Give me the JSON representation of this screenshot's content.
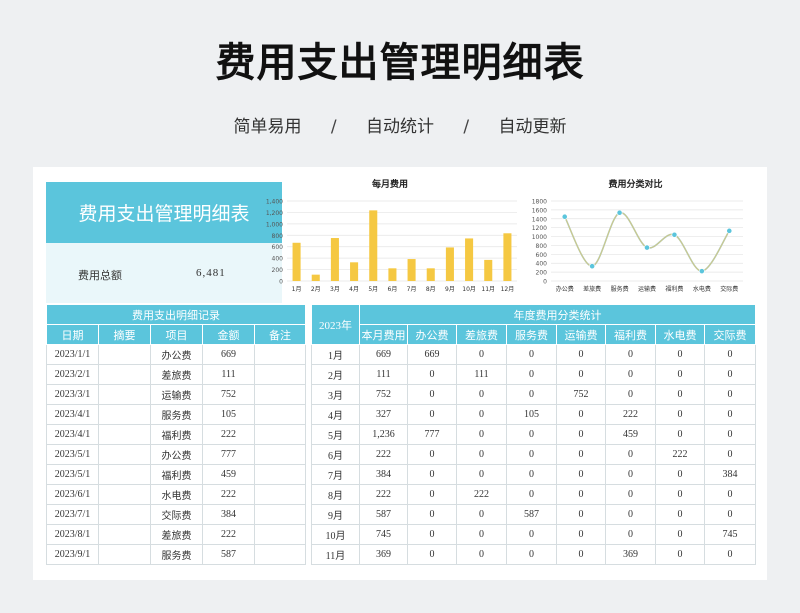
{
  "header": {
    "title": "费用支出管理明细表",
    "tagline": [
      "简单易用",
      "自动统计",
      "自动更新"
    ],
    "separator": "/"
  },
  "summary": {
    "banner_title": "费用支出管理明细表",
    "total_label": "费用总额",
    "total_value": "6,481"
  },
  "colors": {
    "accent": "#5bc5dc",
    "bar": "#f5c842",
    "line_yellow": "#f2c94c",
    "line_blue": "#9ec9d8",
    "marker": "#5bc5dc"
  },
  "chart_data": [
    {
      "type": "bar",
      "title": "每月费用",
      "categories": [
        "1月",
        "2月",
        "3月",
        "4月",
        "5月",
        "6月",
        "7月",
        "8月",
        "9月",
        "10月",
        "11月",
        "12月"
      ],
      "values": [
        669,
        111,
        752,
        327,
        1236,
        222,
        384,
        222,
        587,
        745,
        369,
        835
      ],
      "ylim": [
        0,
        1400
      ],
      "yticks": [
        "0",
        "200",
        "400",
        "600",
        "800",
        "1,000",
        "1,200",
        "1,400"
      ],
      "grid": true
    },
    {
      "type": "line",
      "title": "费用分类对比",
      "categories": [
        "办公费",
        "差旅费",
        "服务费",
        "运输费",
        "福利费",
        "水电费",
        "交际费"
      ],
      "values": [
        1446,
        333,
        1536,
        752,
        1040,
        222,
        1129
      ],
      "ylim": [
        0,
        1800
      ],
      "yticks": [
        "0",
        "200",
        "400",
        "600",
        "800",
        "1000",
        "1200",
        "1400",
        "1600",
        "1800"
      ],
      "grid": true
    }
  ],
  "detail": {
    "section_title": "费用支出明细记录",
    "columns": [
      "日期",
      "摘要",
      "项目",
      "金额",
      "备注"
    ],
    "rows": [
      [
        "2023/1/1",
        "",
        "办公费",
        "669",
        ""
      ],
      [
        "2023/2/1",
        "",
        "差旅费",
        "111",
        ""
      ],
      [
        "2023/3/1",
        "",
        "运输费",
        "752",
        ""
      ],
      [
        "2023/4/1",
        "",
        "服务费",
        "105",
        ""
      ],
      [
        "2023/4/1",
        "",
        "福利费",
        "222",
        ""
      ],
      [
        "2023/5/1",
        "",
        "办公费",
        "777",
        ""
      ],
      [
        "2023/5/1",
        "",
        "福利费",
        "459",
        ""
      ],
      [
        "2023/6/1",
        "",
        "水电费",
        "222",
        ""
      ],
      [
        "2023/7/1",
        "",
        "交际费",
        "384",
        ""
      ],
      [
        "2023/8/1",
        "",
        "差旅费",
        "222",
        ""
      ],
      [
        "2023/9/1",
        "",
        "服务费",
        "587",
        ""
      ]
    ]
  },
  "annual": {
    "year_label": "2023年",
    "section_title": "年度费用分类统计",
    "columns": [
      "本月费用",
      "办公费",
      "差旅费",
      "服务费",
      "运输费",
      "福利费",
      "水电费",
      "交际费"
    ],
    "rows": [
      [
        "1月",
        "669",
        "669",
        "0",
        "0",
        "0",
        "0",
        "0",
        "0"
      ],
      [
        "2月",
        "111",
        "0",
        "111",
        "0",
        "0",
        "0",
        "0",
        "0"
      ],
      [
        "3月",
        "752",
        "0",
        "0",
        "0",
        "752",
        "0",
        "0",
        "0"
      ],
      [
        "4月",
        "327",
        "0",
        "0",
        "105",
        "0",
        "222",
        "0",
        "0"
      ],
      [
        "5月",
        "1,236",
        "777",
        "0",
        "0",
        "0",
        "459",
        "0",
        "0"
      ],
      [
        "6月",
        "222",
        "0",
        "0",
        "0",
        "0",
        "0",
        "222",
        "0"
      ],
      [
        "7月",
        "384",
        "0",
        "0",
        "0",
        "0",
        "0",
        "0",
        "384"
      ],
      [
        "8月",
        "222",
        "0",
        "222",
        "0",
        "0",
        "0",
        "0",
        "0"
      ],
      [
        "9月",
        "587",
        "0",
        "0",
        "587",
        "0",
        "0",
        "0",
        "0"
      ],
      [
        "10月",
        "745",
        "0",
        "0",
        "0",
        "0",
        "0",
        "0",
        "745"
      ],
      [
        "11月",
        "369",
        "0",
        "0",
        "0",
        "0",
        "369",
        "0",
        "0"
      ]
    ]
  }
}
